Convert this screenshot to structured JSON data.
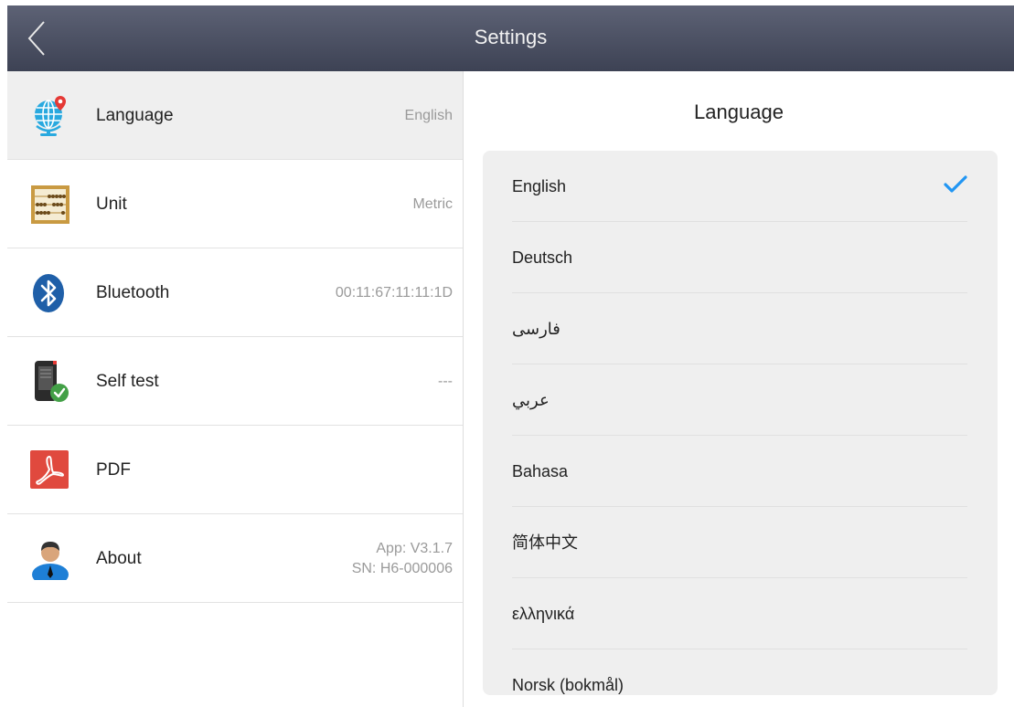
{
  "header": {
    "title": "Settings"
  },
  "settings": {
    "items": [
      {
        "label": "Language",
        "value": "English"
      },
      {
        "label": "Unit",
        "value": "Metric"
      },
      {
        "label": "Bluetooth",
        "value": "00:11:67:11:11:1D"
      },
      {
        "label": "Self test",
        "value": "---"
      },
      {
        "label": "PDF",
        "value": ""
      },
      {
        "label": "About",
        "value_line1": "App: V3.1.7",
        "value_line2": "SN: H6-000006"
      }
    ]
  },
  "language_panel": {
    "title": "Language",
    "selected": "English",
    "options": [
      "English",
      "Deutsch",
      "فارسی",
      "عربي",
      "Bahasa",
      "简体中文",
      "ελληνικά",
      "Norsk (bokmål)"
    ]
  },
  "colors": {
    "header": "#4a4f62",
    "accent": "#2196f3",
    "selected_row": "#efefef",
    "pdf_red": "#e0493e"
  }
}
